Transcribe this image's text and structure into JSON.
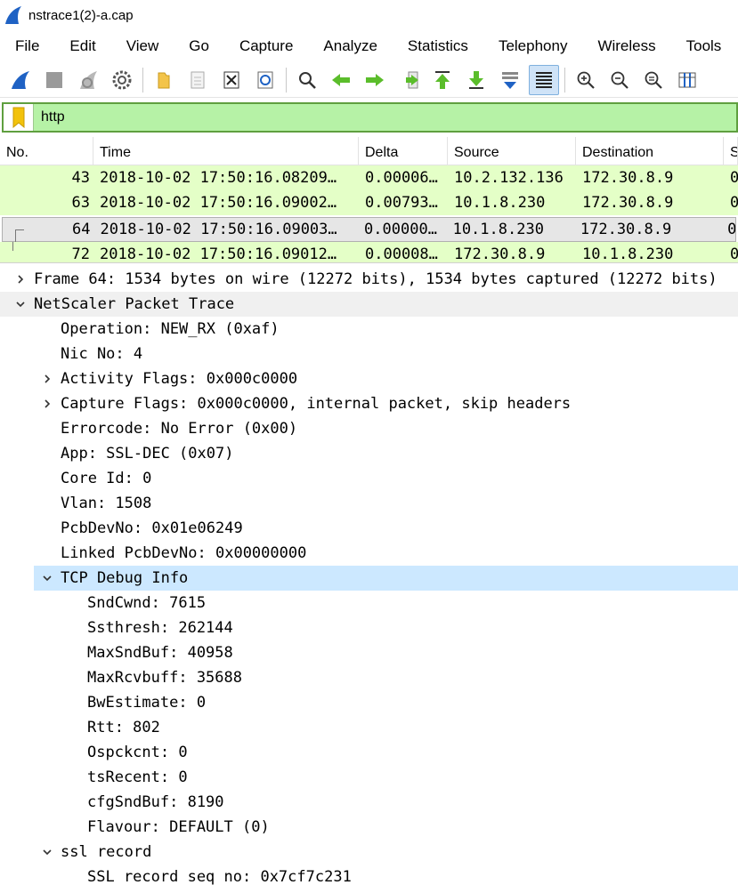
{
  "window": {
    "title": "nstrace1(2)-a.cap"
  },
  "menu": [
    "File",
    "Edit",
    "View",
    "Go",
    "Capture",
    "Analyze",
    "Statistics",
    "Telephony",
    "Wireless",
    "Tools"
  ],
  "filter": {
    "value": "http"
  },
  "packet_list": {
    "columns": [
      "No.",
      "Time",
      "Delta",
      "Source",
      "Destination",
      "S"
    ],
    "rows": [
      {
        "no": "43",
        "time": "2018-10-02 17:50:16.08209…",
        "delta": "0.00006…",
        "source": "10.2.132.136",
        "destination": "172.30.8.9",
        "s": "0"
      },
      {
        "no": "63",
        "time": "2018-10-02 17:50:16.09002…",
        "delta": "0.00793…",
        "source": "10.1.8.230",
        "destination": "172.30.8.9",
        "s": "0"
      },
      {
        "no": "64",
        "time": "2018-10-02 17:50:16.09003…",
        "delta": "0.00000…",
        "source": "10.1.8.230",
        "destination": "172.30.8.9",
        "s": "0"
      },
      {
        "no": "72",
        "time": "2018-10-02 17:50:16.09012…",
        "delta": "0.00008…",
        "source": "172.30.8.9",
        "destination": "10.1.8.230",
        "s": "0"
      }
    ],
    "row_color": "#e4ffc7"
  },
  "details": [
    {
      "text": "Frame 64: 1534 bytes on wire (12272 bits), 1534 bytes captured (12272 bits)",
      "level": 0,
      "expander": "collapsed"
    },
    {
      "text": "NetScaler Packet Trace",
      "level": 0,
      "expander": "expanded",
      "section": true
    },
    {
      "text": "Operation: NEW_RX (0xaf)",
      "level": 1
    },
    {
      "text": "Nic No: 4",
      "level": 1
    },
    {
      "text": "Activity Flags: 0x000c0000",
      "level": 1,
      "expander": "collapsed"
    },
    {
      "text": "Capture Flags: 0x000c0000, internal packet, skip headers",
      "level": 1,
      "expander": "collapsed"
    },
    {
      "text": "Errorcode: No Error (0x00)",
      "level": 1
    },
    {
      "text": "App: SSL-DEC (0x07)",
      "level": 1
    },
    {
      "text": "Core Id: 0",
      "level": 1
    },
    {
      "text": "Vlan: 1508",
      "level": 1
    },
    {
      "text": "PcbDevNo: 0x01e06249",
      "level": 1
    },
    {
      "text": "Linked PcbDevNo: 0x00000000",
      "level": 1
    },
    {
      "text": "TCP Debug Info",
      "level": 1,
      "expander": "expanded",
      "highlight": true
    },
    {
      "text": "SndCwnd: 7615",
      "level": 2
    },
    {
      "text": "Ssthresh: 262144",
      "level": 2
    },
    {
      "text": "MaxSndBuf: 40958",
      "level": 2
    },
    {
      "text": "MaxRcvbuff: 35688",
      "level": 2
    },
    {
      "text": "BwEstimate: 0",
      "level": 2
    },
    {
      "text": "Rtt: 802",
      "level": 2
    },
    {
      "text": "Ospckcnt: 0",
      "level": 2
    },
    {
      "text": "tsRecent: 0",
      "level": 2
    },
    {
      "text": "cfgSndBuf: 8190",
      "level": 2
    },
    {
      "text": "Flavour: DEFAULT (0)",
      "level": 2
    },
    {
      "text": "ssl record",
      "level": 1,
      "expander": "expanded"
    },
    {
      "text": "SSL record seq no: 0x7cf7c231",
      "level": 2
    }
  ],
  "colors": {
    "filter_bg": "#b6f2a6",
    "highlight": "#cce8ff",
    "section": "#f0f0f0"
  }
}
